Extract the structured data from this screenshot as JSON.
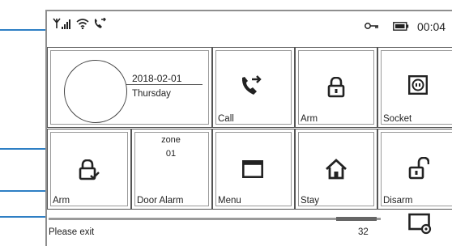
{
  "status_bar": {
    "icons": [
      "antenna-icon",
      "signal-bars-icon",
      "wifi-icon",
      "call-forward-icon"
    ],
    "right_icons": [
      "key-icon",
      "battery-icon"
    ],
    "time": "00:04"
  },
  "date_panel": {
    "date": "2018-02-01",
    "weekday": "Thursday"
  },
  "tiles": {
    "call": {
      "label": "Call",
      "icon": "phone-call-icon"
    },
    "arm_top": {
      "label": "Arm",
      "icon": "padlock-closed-icon"
    },
    "socket": {
      "label": "Socket",
      "icon": "power-socket-icon"
    },
    "arm_bottom": {
      "label": "Arm",
      "icon": "padlock-check-icon"
    },
    "door_alarm": {
      "label": "Door Alarm",
      "zone_label": "zone",
      "zone_number": "01"
    },
    "menu": {
      "label": "Menu",
      "icon": "window-icon"
    },
    "stay": {
      "label": "Stay",
      "icon": "home-icon"
    },
    "disarm": {
      "label": "Disarm",
      "icon": "padlock-open-icon"
    }
  },
  "footer": {
    "message": "Please exit",
    "countdown": "32",
    "progress_fraction": 0.9,
    "icon": "screen-settings-icon"
  },
  "colors": {
    "callout_lines": "#2e7fc4",
    "border": "#555555"
  }
}
